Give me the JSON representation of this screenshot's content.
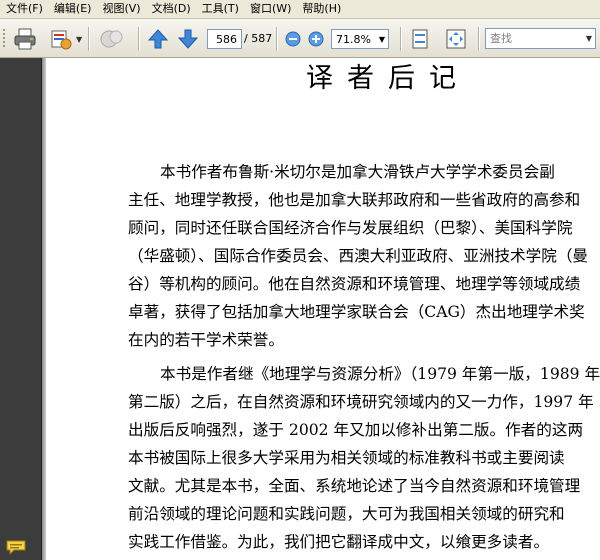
{
  "menu": [
    "文件(F)",
    "编辑(E)",
    "视图(V)",
    "文档(D)",
    "工具(T)",
    "窗口(W)",
    "帮助(H)"
  ],
  "toolbar": {
    "current_page": "586",
    "page_total": "/ 587",
    "zoom": "71.8%",
    "search_placeholder": "查找",
    "icons": [
      "print-icon",
      "email-icon",
      "collaborate-icon",
      "prev-page-icon",
      "next-page-icon",
      "zoom-out-icon",
      "zoom-in-icon",
      "fit-width-icon",
      "fit-page-icon",
      "search-dropdown-icon"
    ]
  },
  "document": {
    "title": "译者后记",
    "lines": [
      "本书作者布鲁斯·米切尔是加拿大滑铁卢大学学术委员会副",
      "主任、地理学教授，他也是加拿大联邦政府和一些省政府的高参和",
      "顾问，同时还任联合国经济合作与发展组织（巴黎）、美国科学院",
      "（华盛顿）、国际合作委员会、西澳大利亚政府、亚洲技术学院（曼",
      "谷）等机构的顾问。他在自然资源和环境管理、地理学等领域成绩",
      "卓著，获得了包括加拿大地理学家联合会（CAG）杰出地理学术奖",
      "在内的若干学术荣誉。",
      "本书是作者继《地理学与资源分析》（1979 年第一版，1989 年",
      "第二版）之后，在自然资源和环境研究领域内的又一力作，1997 年",
      "出版后反响强烈，遂于 2002 年又加以修补出第二版。作者的这两",
      "本书被国际上很多大学采用为相关领域的标准教科书或主要阅读",
      "文献。尤其是本书，全面、系统地论述了当今自然资源和环境管理",
      "前沿领域的理论问题和实践问题，大可为我国相关领域的研究和",
      "实践工作借鉴。为此，我们把它翻译成中文，以飨更多读者。"
    ]
  },
  "nav": {
    "comments_icon": "comment-icon"
  }
}
